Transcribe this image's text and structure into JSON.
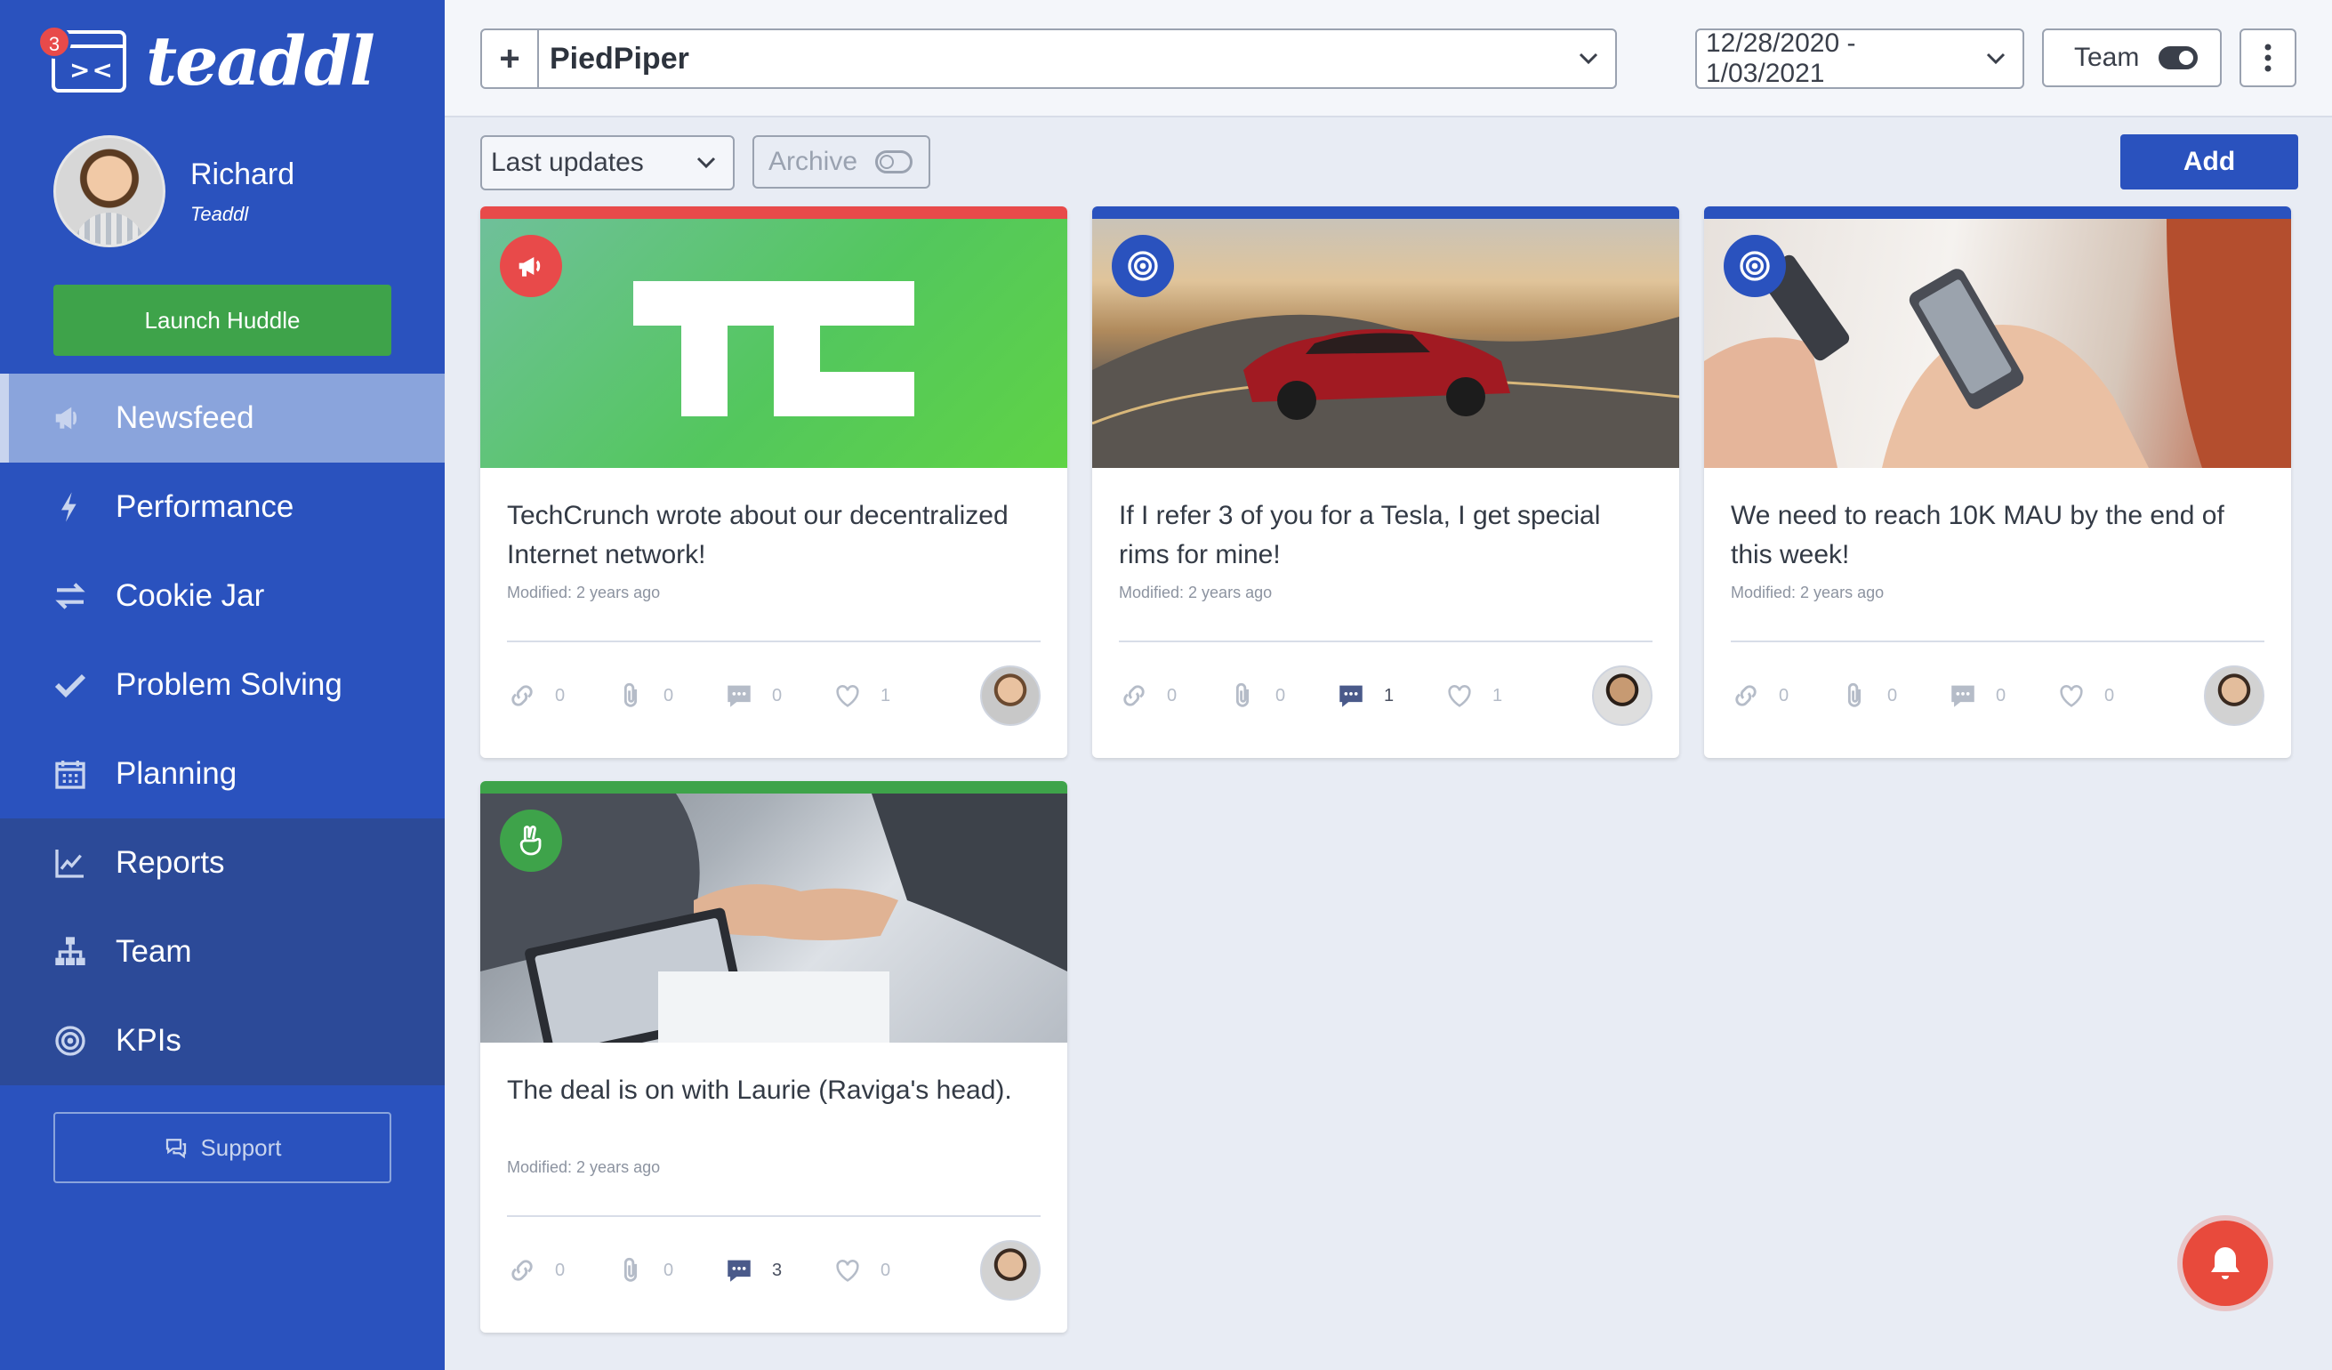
{
  "app": {
    "logo_text": "teaddl",
    "notification_count": "3"
  },
  "profile": {
    "name": "Richard",
    "org": "Teaddl"
  },
  "sidebar": {
    "launch_label": "Launch Huddle",
    "items": [
      {
        "label": "Newsfeed",
        "icon": "megaphone-icon",
        "state": "active"
      },
      {
        "label": "Performance",
        "icon": "lightning-icon",
        "state": "normal"
      },
      {
        "label": "Cookie Jar",
        "icon": "exchange-icon",
        "state": "normal"
      },
      {
        "label": "Problem Solving",
        "icon": "check-icon",
        "state": "normal"
      },
      {
        "label": "Planning",
        "icon": "calendar-icon",
        "state": "normal"
      },
      {
        "label": "Reports",
        "icon": "chart-line-icon",
        "state": "dark"
      },
      {
        "label": "Team",
        "icon": "org-chart-icon",
        "state": "dark"
      },
      {
        "label": "KPIs",
        "icon": "target-icon",
        "state": "dark"
      }
    ],
    "support_label": "Support"
  },
  "topbar": {
    "project": "PiedPiper",
    "date_range": "12/28/2020 - 1/03/2021",
    "team_label": "Team",
    "team_toggle_on": true
  },
  "filters": {
    "sort": "Last updates",
    "archive_label": "Archive",
    "archive_on": false,
    "add_label": "Add"
  },
  "colors": {
    "sidebar": "#2a52be",
    "accent": "#2a52be",
    "launch": "#3ea34a",
    "announcement": "#e84a4a",
    "kpi": "#2a52be",
    "win": "#3ea34a"
  },
  "cards": [
    {
      "title": "TechCrunch wrote about our decentralized Internet network!",
      "modified": "Modified: 2 years ago",
      "type_icon": "megaphone-icon",
      "strip_color": "#e84a4a",
      "links": "0",
      "attachments": "0",
      "comments": "0",
      "likes": "1"
    },
    {
      "title": "If I refer 3 of you for a Tesla, I get special rims for mine!",
      "modified": "Modified: 2 years ago",
      "type_icon": "target-icon",
      "strip_color": "#2a52be",
      "links": "0",
      "attachments": "0",
      "comments": "1",
      "likes": "1"
    },
    {
      "title": "We need to reach 10K MAU by the end of this week!",
      "modified": "Modified: 2 years ago",
      "type_icon": "target-icon",
      "strip_color": "#2a52be",
      "links": "0",
      "attachments": "0",
      "comments": "0",
      "likes": "0"
    },
    {
      "title": "The deal is on with Laurie (Raviga's head).",
      "modified": "Modified: 2 years ago",
      "type_icon": "victory-hand-icon",
      "strip_color": "#3ea34a",
      "links": "0",
      "attachments": "0",
      "comments": "3",
      "likes": "0"
    }
  ]
}
